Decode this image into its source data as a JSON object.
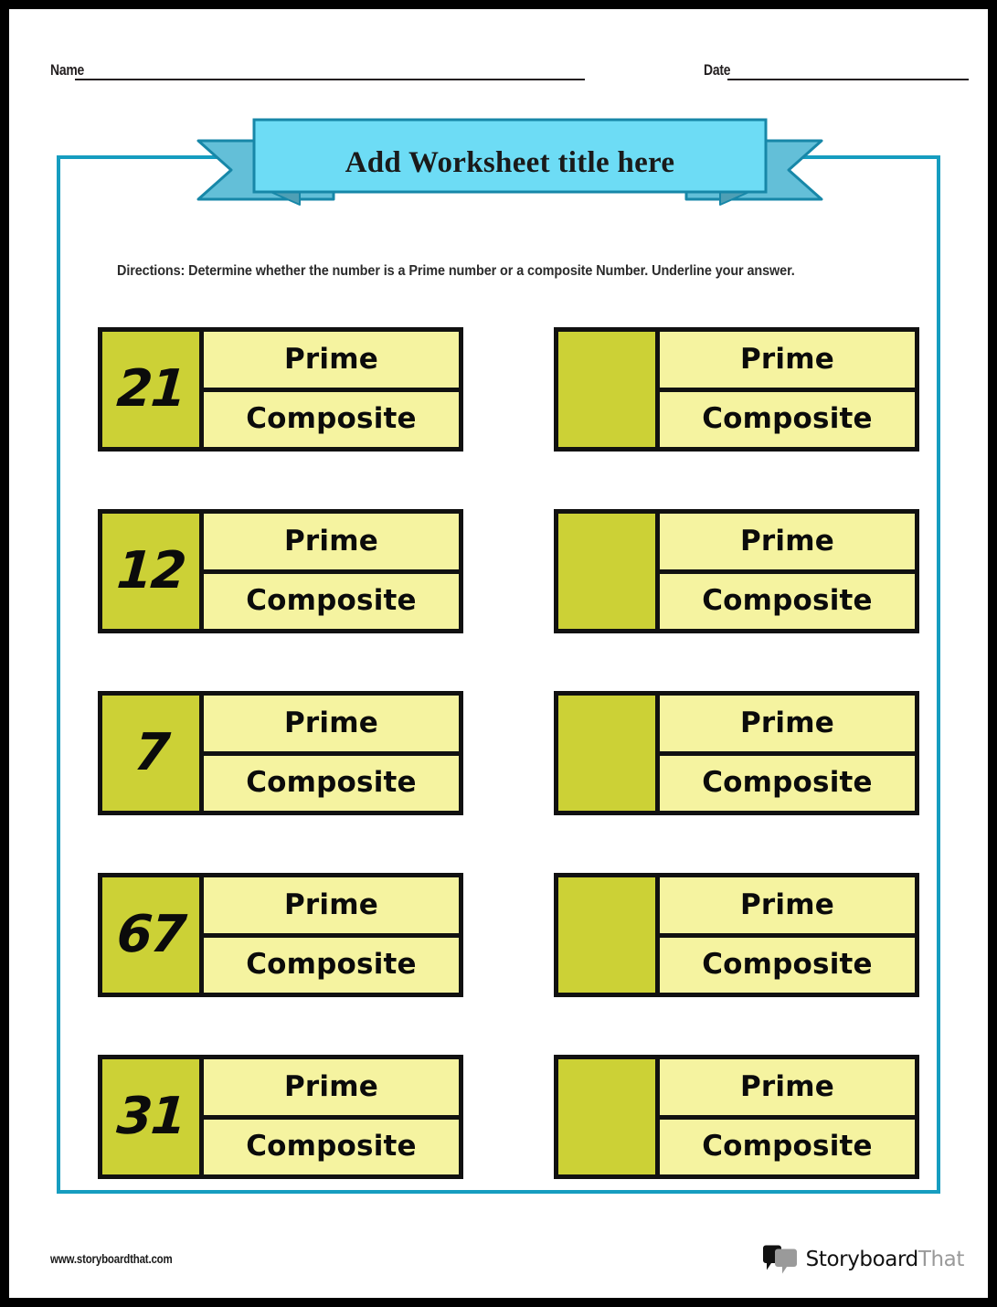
{
  "theme": {
    "page_border": "#000000",
    "frame_color": "#169dc0",
    "banner_panel": "#6ddcf5",
    "banner_tail": "#63bfd8",
    "banner_tail_shadow": "#4e9fb5",
    "banner_stroke": "#1787a8",
    "number_box": "#ccd136",
    "answer_box": "#f5f3a0",
    "box_border": "#111111",
    "text_color": "#0b0b0b"
  },
  "header": {
    "name_label": "Name",
    "date_label": "Date"
  },
  "banner": {
    "title": "Add Worksheet title here"
  },
  "directions": {
    "text": "Directions: Determine whether the number is a Prime number or a composite Number. Underline your answer."
  },
  "options": {
    "prime": "Prime",
    "composite": "Composite"
  },
  "questions": [
    {
      "number": "21",
      "prime": "Prime",
      "composite": "Composite"
    },
    {
      "number": "",
      "prime": "Prime",
      "composite": "Composite"
    },
    {
      "number": "12",
      "prime": "Prime",
      "composite": "Composite"
    },
    {
      "number": "",
      "prime": "Prime",
      "composite": "Composite"
    },
    {
      "number": "7",
      "prime": "Prime",
      "composite": "Composite"
    },
    {
      "number": "",
      "prime": "Prime",
      "composite": "Composite"
    },
    {
      "number": "67",
      "prime": "Prime",
      "composite": "Composite"
    },
    {
      "number": "",
      "prime": "Prime",
      "composite": "Composite"
    },
    {
      "number": "31",
      "prime": "Prime",
      "composite": "Composite"
    },
    {
      "number": "",
      "prime": "Prime",
      "composite": "Composite"
    }
  ],
  "footer": {
    "url": "www.storyboardthat.com",
    "logo_text_dark": "Storyboard",
    "logo_text_light": "That"
  }
}
